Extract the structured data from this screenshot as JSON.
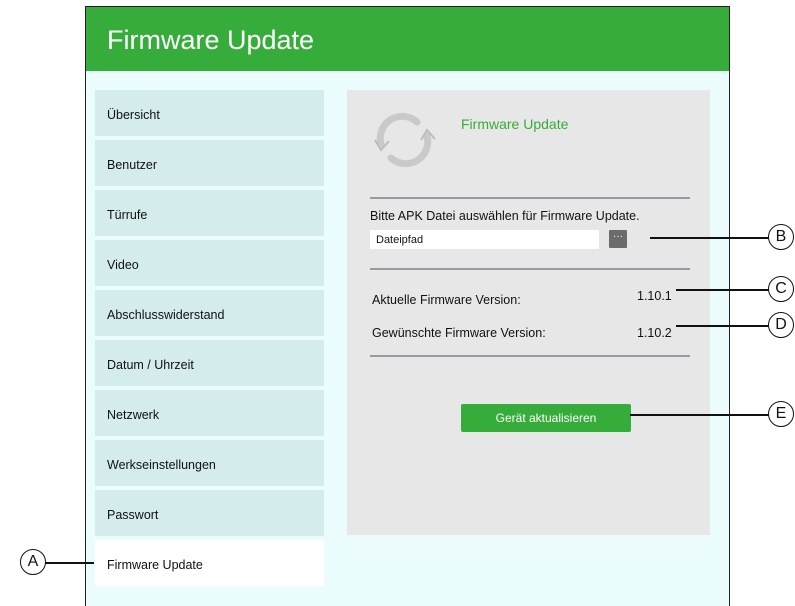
{
  "header": {
    "title": "Firmware Update"
  },
  "sidebar": {
    "items": [
      {
        "label": "Übersicht"
      },
      {
        "label": "Benutzer"
      },
      {
        "label": "Türrufe"
      },
      {
        "label": "Video"
      },
      {
        "label": "Abschlusswiderstand"
      },
      {
        "label": "Datum / Uhrzeit"
      },
      {
        "label": "Netzwerk"
      },
      {
        "label": "Werkseinstellungen"
      },
      {
        "label": "Passwort"
      },
      {
        "label": "Firmware Update"
      }
    ],
    "active_index": 9
  },
  "panel": {
    "title": "Firmware Update",
    "icon": "firmware-update-icon",
    "select_label": "Bitte APK Datei auswählen für Firmware Update.",
    "path_field": {
      "value": "Dateipfad"
    },
    "browse_label": "···",
    "current_label": "Aktuelle Firmware Version:",
    "current_value": "1.10.1",
    "desired_label": "Gewünschte Firmware Version:",
    "desired_value": "1.10.2",
    "update_button": "Gerät aktualisieren"
  },
  "callouts": {
    "a": "A",
    "b": "B",
    "c": "C",
    "d": "D",
    "e": "E"
  },
  "colors": {
    "header": "#36ad3a",
    "accent": "#36ad3a",
    "background": "#eafcfc",
    "sidebar_item": "#d5ecec",
    "panel": "#e7e7e7"
  }
}
